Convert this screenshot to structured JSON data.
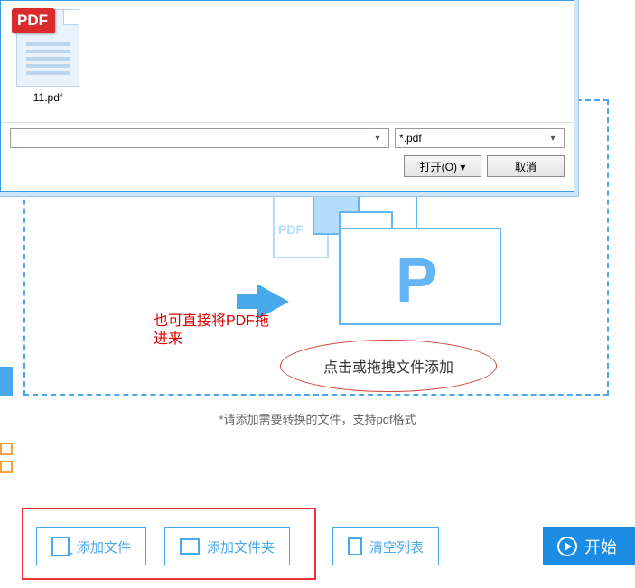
{
  "dialog": {
    "file_name": "11.pdf",
    "pdf_badge": "PDF",
    "filter_label": "*.pdf",
    "open_label": "打开(O)",
    "cancel_label": "取消"
  },
  "drop": {
    "annotation": "也可直接将PDF拖进来",
    "ellipse_text": "点击或拖拽文件添加",
    "hint": "*请添加需要转换的文件，支持pdf格式",
    "pdf_stack_label": "PDF"
  },
  "toolbar": {
    "add_file": "添加文件",
    "add_folder": "添加文件夹",
    "clear_list": "清空列表",
    "start": "开始"
  }
}
